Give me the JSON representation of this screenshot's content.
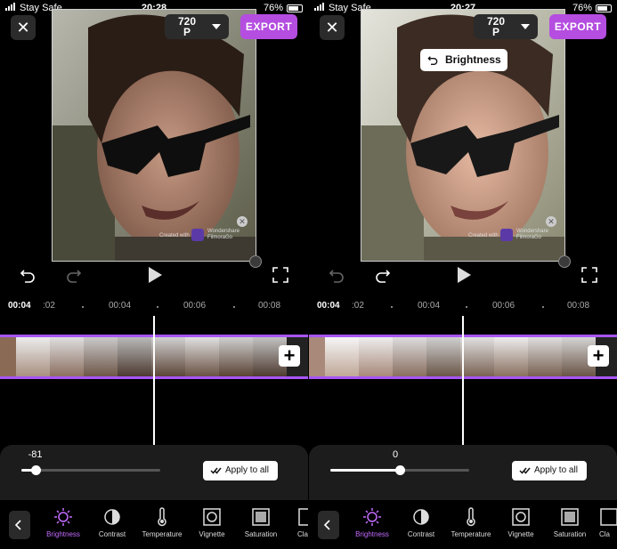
{
  "status": {
    "carrier": "Stay Safe",
    "battery": "76%"
  },
  "left": {
    "time": "20:28",
    "slider_value": "-81",
    "slider_fraction": 0.1,
    "tooltip": ""
  },
  "right": {
    "time": "20:27",
    "slider_value": "0",
    "slider_fraction": 0.5,
    "tooltip": "Brightness"
  },
  "toolbar": {
    "resolution_label": "720\nP",
    "resolution_line1": "720",
    "resolution_line2": "P",
    "export_label": "EXPORT",
    "apply_label": "Apply to all",
    "tools": [
      "Brightness",
      "Contrast",
      "Temperature",
      "Vignette",
      "Saturation",
      "Cla"
    ]
  },
  "watermark": {
    "created_with": "Created with",
    "brand_line1": "Wondershare",
    "brand_line2": "FilmoraGo"
  },
  "timeline": {
    "current": "00:04",
    "marks": [
      ":02",
      "00:04",
      "00:06",
      "00:08"
    ]
  },
  "colors": {
    "accent": "#b44de0",
    "active_tool": "#c36bff",
    "strip_border": "#a855f7"
  }
}
